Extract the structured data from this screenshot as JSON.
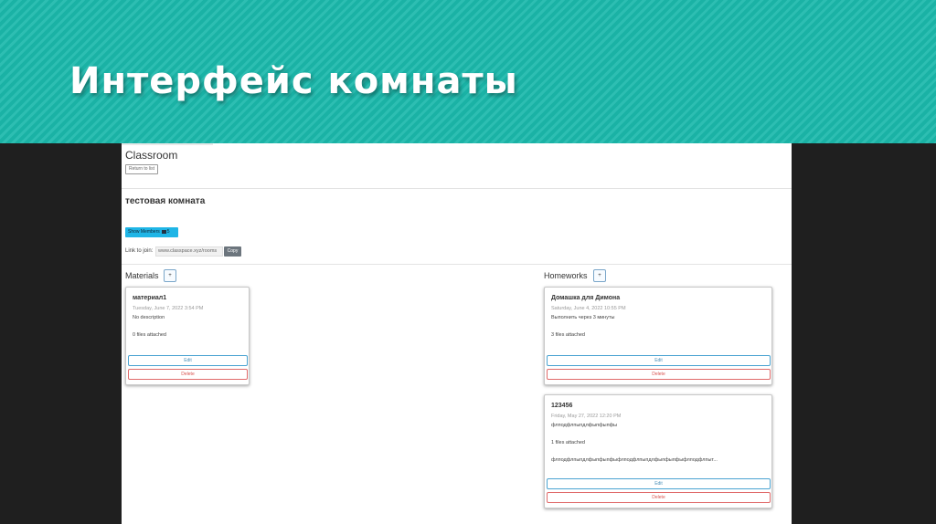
{
  "slide": {
    "title": "Интерфейс комнаты"
  },
  "app": {
    "title": "Classroom",
    "return_label": "Return to list",
    "room_name": "тестовая комната",
    "members_label": "Show Members",
    "members_count": "5",
    "join_label": "Link to join:",
    "join_value": "www.classpace.xyz/rooms",
    "copy_label": "Copy"
  },
  "materials": {
    "title": "Materials",
    "add_label": "+",
    "items": [
      {
        "title": "материал1",
        "date": "Tuesday, June 7, 2022 3:54 PM",
        "description": "No description",
        "files": "0 files attached",
        "edit": "Edit",
        "delete": "Delete"
      }
    ]
  },
  "homeworks": {
    "title": "Homeworks",
    "add_label": "+",
    "items": [
      {
        "title": "Домашка для Димона",
        "date": "Saturday, June 4, 2022 10:55 PM",
        "description": "Выполнить через 3 минуты",
        "files": "3 files attached",
        "edit": "Edit",
        "delete": "Delete"
      },
      {
        "title": "123456",
        "date": "Friday, May 27, 2022 12:20 PM",
        "description": "флподфлпыпдлфыпфыпфы",
        "files": "1 files attached",
        "extra": "флподфлпыпдлфыпфыпфыфлподфлпыпдлфыпфыпфыфлподфлпыт...",
        "edit": "Edit",
        "delete": "Delete"
      }
    ]
  }
}
